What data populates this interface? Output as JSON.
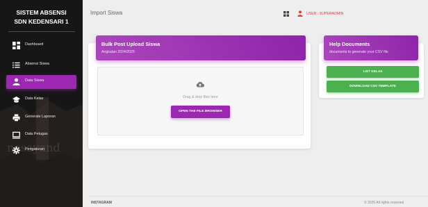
{
  "sidebar": {
    "title_line1": "SISTEM ABSENSI",
    "title_line2": "SDN KEDENSARI 1",
    "items": [
      {
        "label": "Dashboard",
        "icon": "dashboard-icon"
      },
      {
        "label": "Absensi Siswa",
        "icon": "list-icon"
      },
      {
        "label": "Data Siswa",
        "icon": "person-icon"
      },
      {
        "label": "Data Kelas",
        "icon": "school-icon"
      },
      {
        "label": "Generate Laporan",
        "icon": "print-icon"
      },
      {
        "label": "Data Petugas",
        "icon": "monitor-icon"
      },
      {
        "label": "Pengaturan",
        "icon": "gear-icon"
      }
    ],
    "active_index": 2
  },
  "topbar": {
    "page_name": "Import Siswa",
    "user_label": "USER : SUPERADMIN"
  },
  "upload_card": {
    "title": "Bulk Post Upload Siswa",
    "subtitle": "Angkatan 2024/2025",
    "drop_text": "Drag & drop files here",
    "browse_button": "OPEN THE FILE BROWSER"
  },
  "help_card": {
    "title": "Help Documents",
    "subtitle": "documents to generate your CSV file",
    "list_button": "LIST KELAS",
    "template_button": "DOWNLOAD CSV TEMPLATE"
  },
  "footer": {
    "link": "INSTAGRAM",
    "copyright": "© 2025 All rights reserved"
  },
  "colors": {
    "primary": "#9c27b0",
    "success": "#4caf50",
    "danger": "#e53935"
  }
}
